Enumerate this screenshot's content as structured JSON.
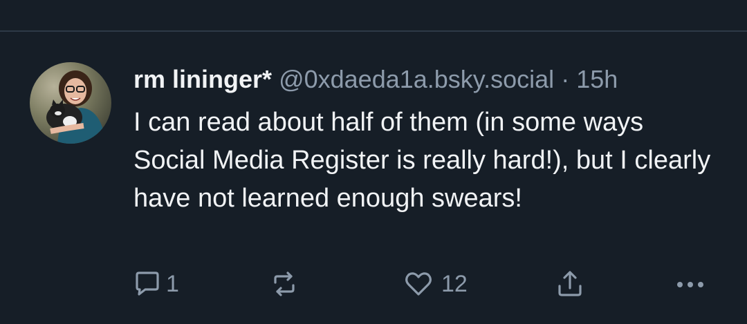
{
  "post": {
    "display_name": "rm lininger*",
    "handle": "@0xdaeda1a.bsky.social",
    "separator": "·",
    "time": "15h",
    "text": "I can read about half of them (in some ways Social Media Register is really hard!), but I clearly have not learned enough swears!",
    "avatar_icon": "profile-photo"
  },
  "actions": {
    "reply": {
      "icon": "reply-icon",
      "count": "1"
    },
    "repost": {
      "icon": "repost-icon",
      "count": ""
    },
    "like": {
      "icon": "heart-icon",
      "count": "12"
    },
    "share": {
      "icon": "share-icon"
    },
    "more": {
      "icon": "more-icon"
    }
  },
  "colors": {
    "background": "#161e27",
    "text": "#f1f3f5",
    "muted": "#8d9bab",
    "divider": "#2e3a47"
  }
}
